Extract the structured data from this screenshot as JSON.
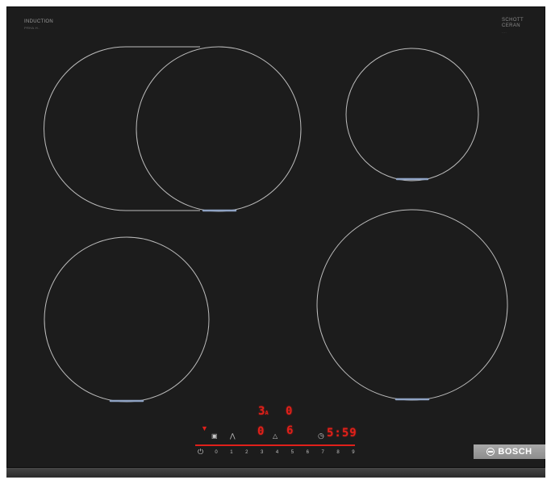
{
  "brand_left": {
    "title": "INDUCTION",
    "subtitle": "PRHA.H.."
  },
  "brand_right": {
    "line1": "SCHOTT",
    "line2": "CERAN",
    "line3": "...."
  },
  "displays": {
    "zone_top_left": "3",
    "zone_top_left_sub": "A",
    "zone_top_right": "0",
    "zone_bottom_left": "0",
    "zone_bottom_right": "6",
    "timer": "5:59"
  },
  "scale": [
    "0",
    "1",
    "2",
    "3",
    "4",
    "5",
    "6",
    "7",
    "8",
    "9"
  ],
  "badge": {
    "brand": "BOSCH"
  },
  "colors": {
    "glass": "#1c1c1c",
    "zone_outline": "#bcbcbc",
    "led_red": "#e0201a",
    "badge": "#9b9b9b"
  },
  "icons": [
    "power-icon",
    "lock-icon",
    "wifi-icon",
    "timer-icon",
    "flame-icon"
  ]
}
